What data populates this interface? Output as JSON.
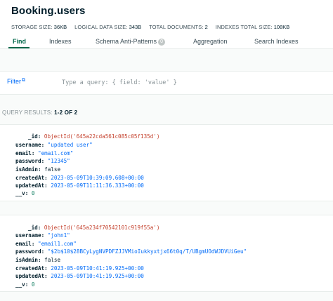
{
  "collection": {
    "title": "Booking.users"
  },
  "stats": [
    {
      "key": "Storage size:",
      "value": "36KB"
    },
    {
      "key": "Logical data size:",
      "value": "343B"
    },
    {
      "key": "Total documents:",
      "value": "2"
    },
    {
      "key": "Indexes total size:",
      "value": "108KB"
    }
  ],
  "tabs": [
    {
      "label": "Find",
      "active": true
    },
    {
      "label": "Indexes"
    },
    {
      "label": "Schema Anti-Patterns",
      "badge": "0"
    },
    {
      "label": "Aggregation"
    },
    {
      "label": "Search Indexes"
    }
  ],
  "query": {
    "filter_label": "Filter",
    "placeholder": "Type a query: { field: 'value' }"
  },
  "results": {
    "label": "QUERY RESULTS:",
    "count": "1-2 OF 2"
  },
  "documents": [
    {
      "fields": [
        {
          "key": "_id:",
          "value": "ObjectId('645a22cda561c085c05f135d')",
          "type": "oid"
        },
        {
          "key": "username:",
          "value": "\"updated user\"",
          "type": "str"
        },
        {
          "key": "email:",
          "value": "\"email.com\"",
          "type": "str"
        },
        {
          "key": "password:",
          "value": "\"12345\"",
          "type": "str"
        },
        {
          "key": "isAdmin:",
          "value": "false",
          "type": "bool"
        },
        {
          "key": "createdAt:",
          "value": "2023-05-09T10:39:09.608+00:00",
          "type": "date"
        },
        {
          "key": "updatedAt:",
          "value": "2023-05-09T11:11:36.333+00:00",
          "type": "date"
        },
        {
          "key": "__v:",
          "value": "0",
          "type": "num"
        }
      ]
    },
    {
      "fields": [
        {
          "key": "_id:",
          "value": "ObjectId('645a234f70542101c919f55a')",
          "type": "oid"
        },
        {
          "key": "username:",
          "value": "\"john1\"",
          "type": "str"
        },
        {
          "key": "email:",
          "value": "\"email1.com\"",
          "type": "str"
        },
        {
          "key": "password:",
          "value": "\"$2b$10$28BCyLygNVPDFZJJVMioIukkyxtjx66t0q/T/UBgmUOdWJDVUiGeu\"",
          "type": "str"
        },
        {
          "key": "isAdmin:",
          "value": "false",
          "type": "bool"
        },
        {
          "key": "createdAt:",
          "value": "2023-05-09T10:41:19.925+00:00",
          "type": "date"
        },
        {
          "key": "updatedAt:",
          "value": "2023-05-09T10:41:19.925+00:00",
          "type": "date"
        },
        {
          "key": "__v:",
          "value": "0",
          "type": "num"
        }
      ]
    }
  ],
  "colors": {
    "accent": "#00684a",
    "link": "#016bf8",
    "objectid": "#c4402c",
    "number": "#0b7b5e"
  }
}
